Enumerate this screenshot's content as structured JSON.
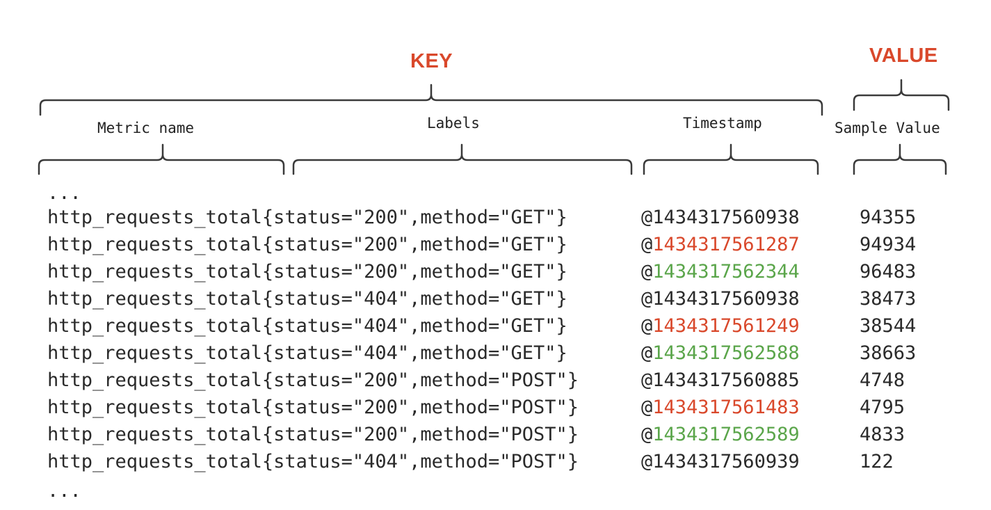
{
  "headers": {
    "key": "KEY",
    "value": "VALUE"
  },
  "captions": {
    "metric_name": "Metric name",
    "labels": "Labels",
    "timestamp": "Timestamp",
    "sample_value": "Sample Value"
  },
  "ellipsis": "...",
  "colors": {
    "accent": "#d9482b",
    "green": "#5aa54a",
    "text": "#2a2a2a"
  },
  "rows": [
    {
      "metric": "http_requests_total{status=\"200\",method=\"GET\"}",
      "at": "@",
      "ts": "1434317560938",
      "ts_color": "default",
      "value": "94355"
    },
    {
      "metric": "http_requests_total{status=\"200\",method=\"GET\"}",
      "at": "@",
      "ts": "1434317561287",
      "ts_color": "red",
      "value": "94934"
    },
    {
      "metric": "http_requests_total{status=\"200\",method=\"GET\"}",
      "at": "@",
      "ts": "1434317562344",
      "ts_color": "green",
      "value": "96483"
    },
    {
      "metric": "http_requests_total{status=\"404\",method=\"GET\"}",
      "at": "@",
      "ts": "1434317560938",
      "ts_color": "default",
      "value": "38473"
    },
    {
      "metric": "http_requests_total{status=\"404\",method=\"GET\"}",
      "at": "@",
      "ts": "1434317561249",
      "ts_color": "red",
      "value": "38544"
    },
    {
      "metric": "http_requests_total{status=\"404\",method=\"GET\"}",
      "at": "@",
      "ts": "1434317562588",
      "ts_color": "green",
      "value": "38663"
    },
    {
      "metric": "http_requests_total{status=\"200\",method=\"POST\"}",
      "at": "@",
      "ts": "1434317560885",
      "ts_color": "default",
      "value": "4748"
    },
    {
      "metric": "http_requests_total{status=\"200\",method=\"POST\"}",
      "at": "@",
      "ts": "1434317561483",
      "ts_color": "red",
      "value": "4795"
    },
    {
      "metric": "http_requests_total{status=\"200\",method=\"POST\"}",
      "at": "@",
      "ts": "1434317562589",
      "ts_color": "green",
      "value": "4833"
    },
    {
      "metric": "http_requests_total{status=\"404\",method=\"POST\"}",
      "at": "@",
      "ts": "1434317560939",
      "ts_color": "default",
      "value": "122"
    }
  ]
}
